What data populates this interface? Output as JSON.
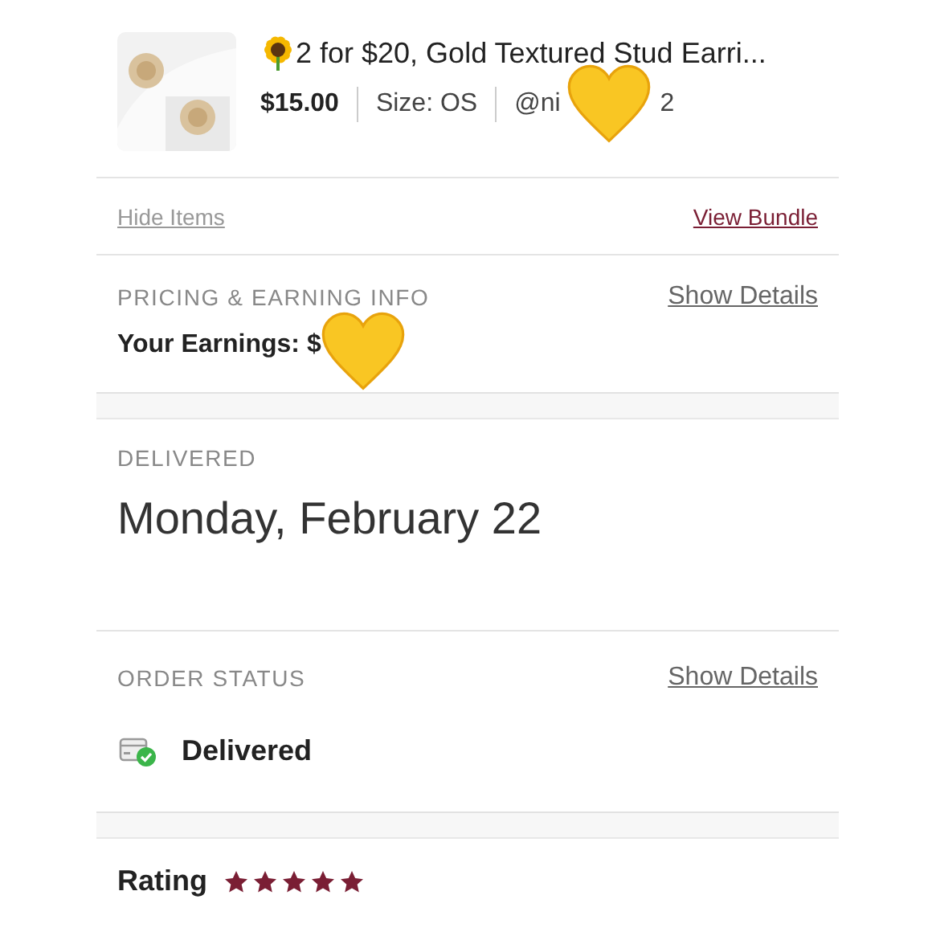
{
  "item": {
    "title": "2 for $20, Gold Textured Stud Earri...",
    "price": "$15.00",
    "size": "Size: OS",
    "seller_parts": [
      "@ni",
      "2"
    ]
  },
  "item_links": [
    {
      "label": "Hide Items",
      "kind": "muted"
    },
    {
      "label": "View Bundle",
      "kind": "accent"
    }
  ],
  "pricing": {
    "heading": "PRICING & EARNING INFO",
    "link": "Show Details",
    "earnings": "Your Earnings: $"
  },
  "delivered": {
    "heading": "DELIVERED",
    "date": "Monday, February 22"
  },
  "order_status": {
    "heading": "ORDER STATUS",
    "link": "Show Details",
    "status": "Delivered"
  },
  "rating": {
    "label": "Rating",
    "stars": 5
  },
  "stickers": [
    {
      "kind": "heart"
    },
    {
      "kind": "heart"
    }
  ]
}
